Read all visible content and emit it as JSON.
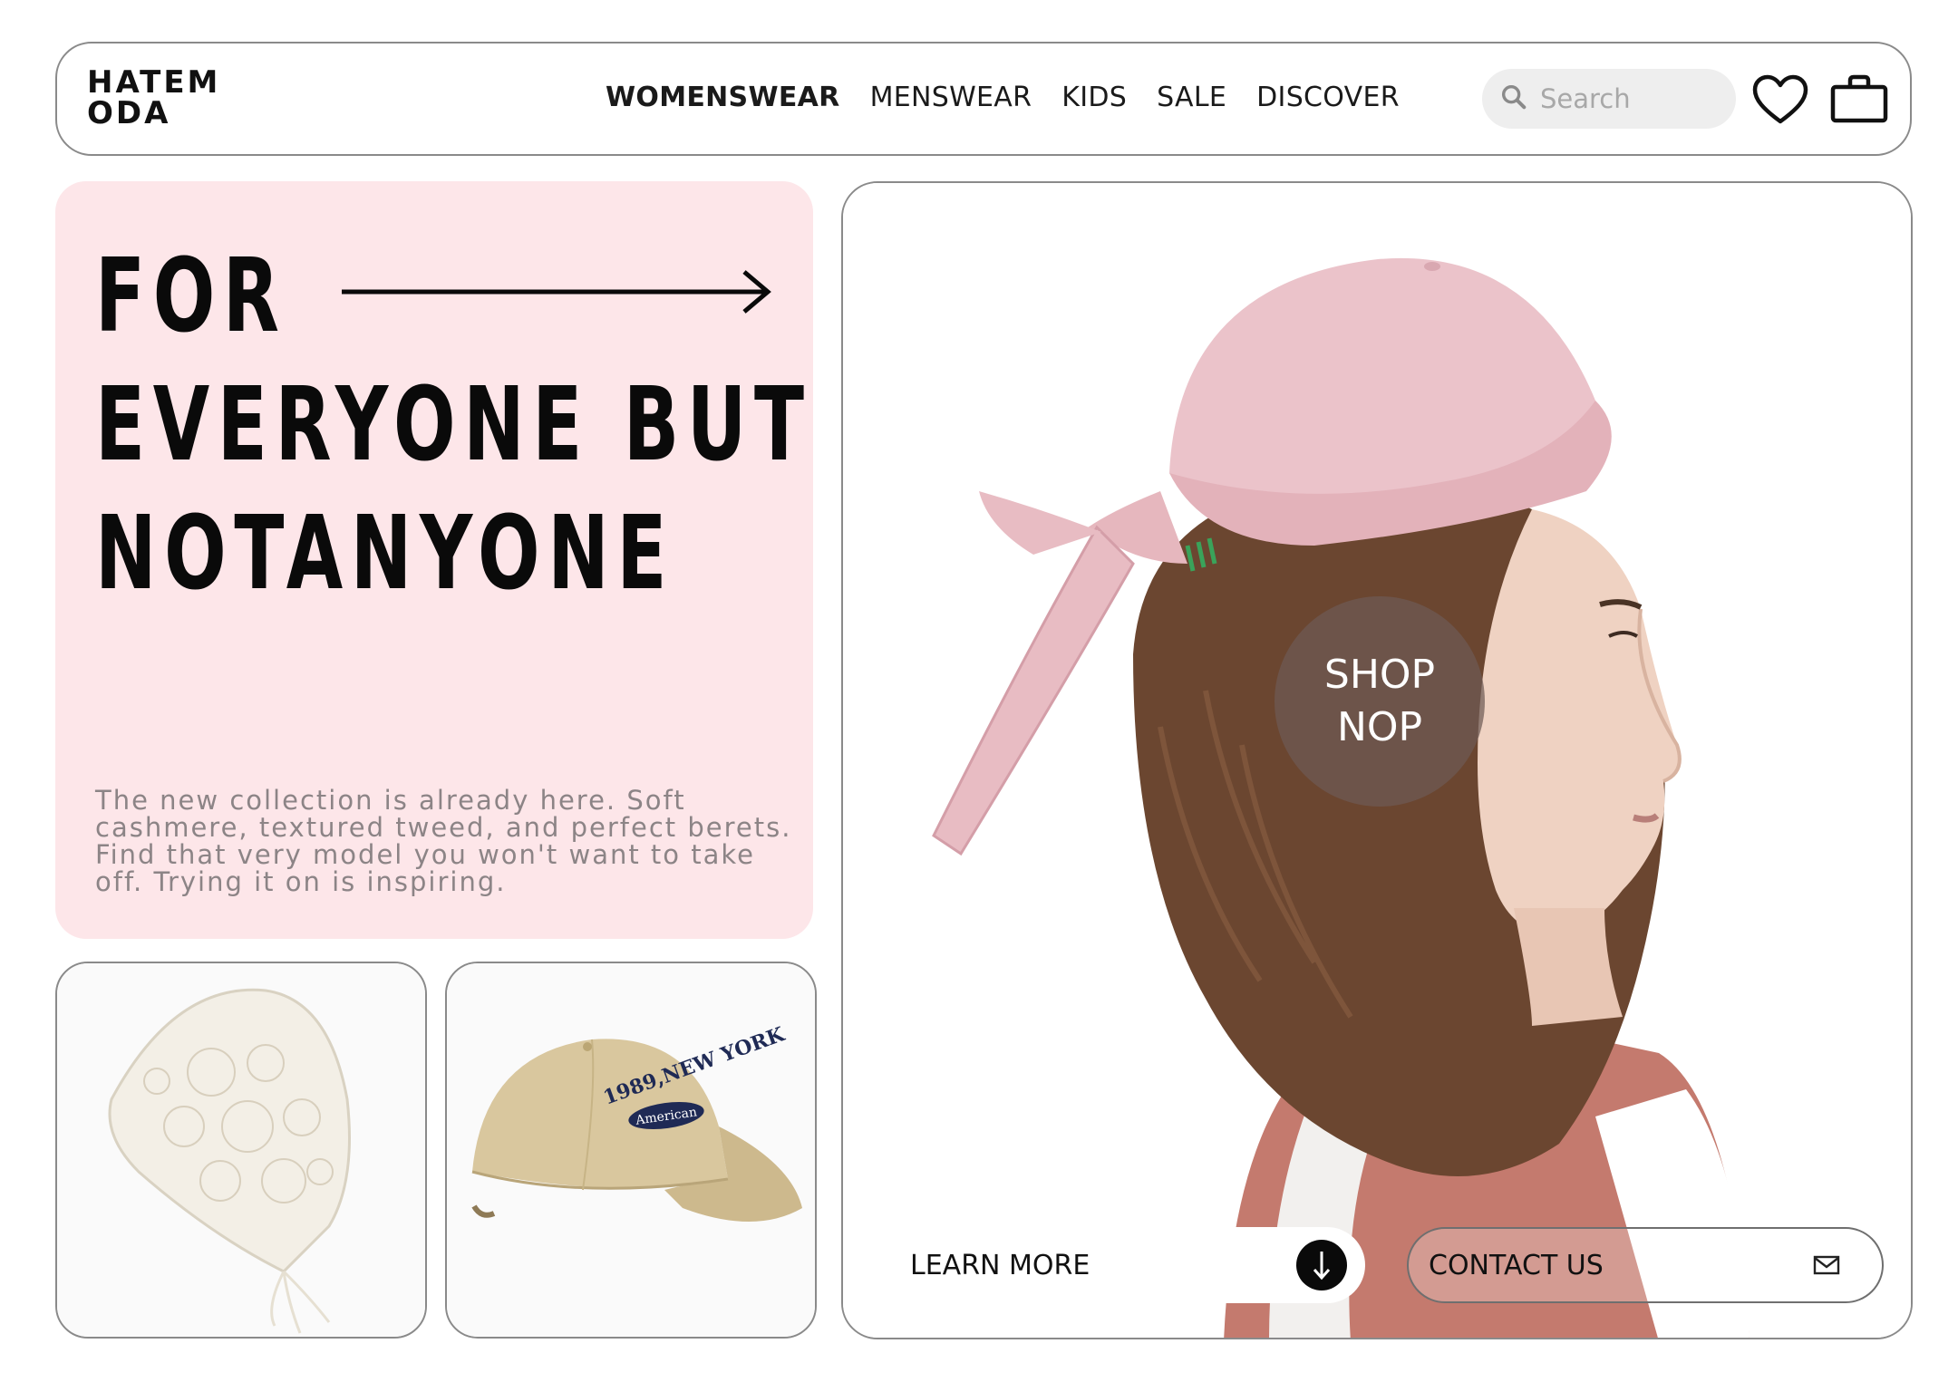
{
  "brand": {
    "line1": "HATEM",
    "line2": "ODA"
  },
  "nav": {
    "items": [
      {
        "label": "WOMENSWEAR",
        "active": true
      },
      {
        "label": "MENSWEAR"
      },
      {
        "label": "KIDS"
      },
      {
        "label": "SALE"
      },
      {
        "label": "DISCOVER"
      }
    ]
  },
  "search": {
    "placeholder": "Search",
    "icon": "search-icon"
  },
  "actions": {
    "wishlist_icon": "heart-icon",
    "cart_icon": "shopping-bag-icon"
  },
  "promo": {
    "headline": [
      "FOR",
      "EVERYONE BUT",
      "NOTANYONE"
    ],
    "arrow_icon": "long-arrow-right-icon",
    "description": "The new collection is already here. Soft cashmere, textured tweed, and perfect berets. Find that very model you won't want to take off. Trying it on is inspiring.",
    "background": "#fde6e9"
  },
  "products": [
    {
      "name": "lace-headscarf"
    },
    {
      "name": "beige-baseball-cap",
      "cap_text": "1989,NEW YORK",
      "cap_badge": "American"
    }
  ],
  "hero": {
    "cta_circle": {
      "line1": "SHOP",
      "line2": "NOP"
    },
    "learn_more": {
      "label": "LEARN MORE",
      "icon": "arrow-down-icon"
    },
    "contact": {
      "label": "CONTACT US",
      "icon": "mail-icon"
    }
  },
  "colors": {
    "promo_pink": "#fde6e9",
    "hat_pink": "#e9bcc3",
    "hair": "#6b4630",
    "jacket": "#c47a6e",
    "cap_beige": "#d9c79e",
    "cap_navy": "#1f2a55"
  }
}
